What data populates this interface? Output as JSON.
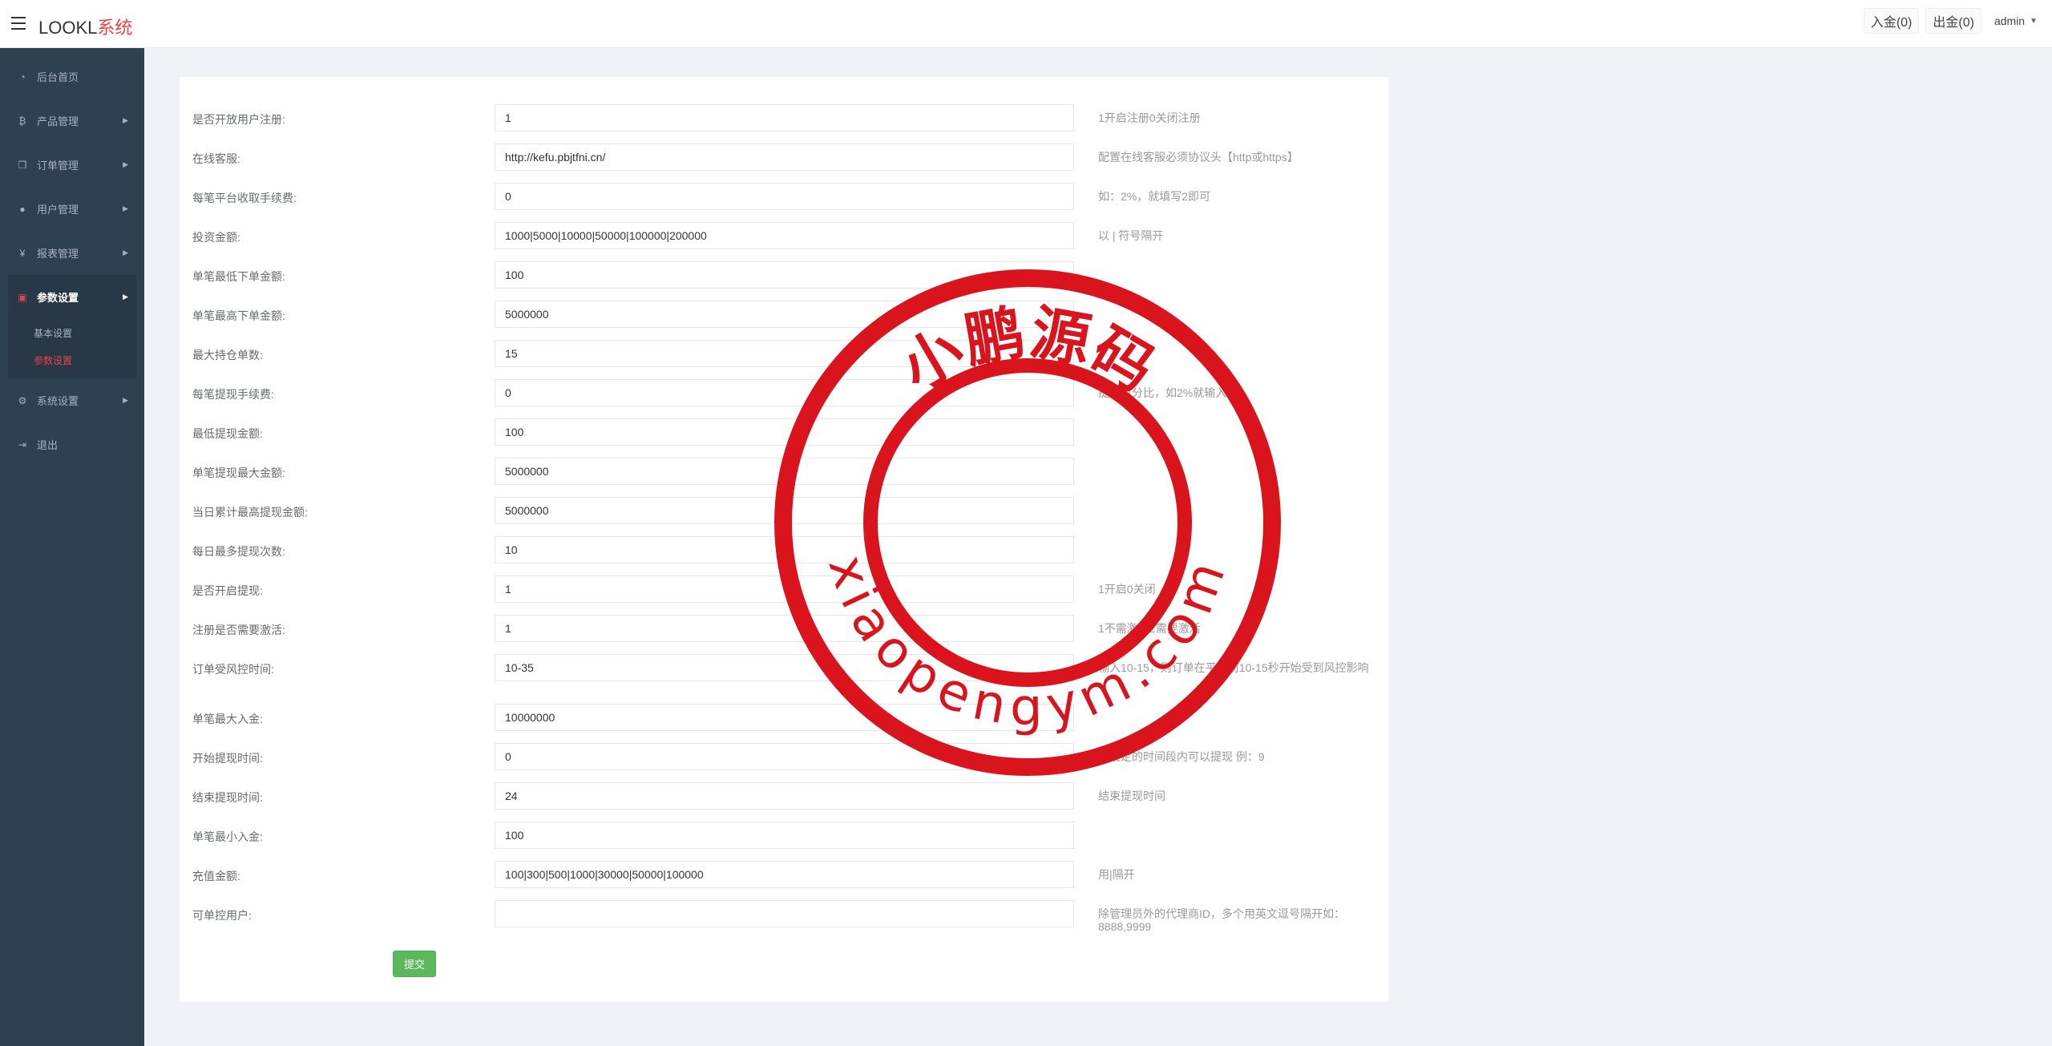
{
  "header": {
    "logo_main": "LOOKL",
    "logo_accent": "系统",
    "deposit": "入金(0)",
    "withdraw": "出金(0)",
    "user": "admin"
  },
  "sidebar": {
    "items": [
      {
        "label": "后台首页",
        "icon": "dashboard-icon",
        "has_arrow": false
      },
      {
        "label": "产品管理",
        "icon": "bitcoin-icon",
        "has_arrow": true
      },
      {
        "label": "订单管理",
        "icon": "copy-icon",
        "has_arrow": true
      },
      {
        "label": "用户管理",
        "icon": "user-icon",
        "has_arrow": true
      },
      {
        "label": "报表管理",
        "icon": "yen-icon",
        "has_arrow": true
      },
      {
        "label": "参数设置",
        "icon": "files-icon",
        "has_arrow": true
      },
      {
        "label": "系统设置",
        "icon": "gears-icon",
        "has_arrow": true
      },
      {
        "label": "退出",
        "icon": "sign-out-icon",
        "has_arrow": false
      }
    ],
    "sub_items": [
      "基本设置",
      "参数设置"
    ]
  },
  "form": {
    "rows": [
      {
        "label": "是否开放用户注册:",
        "value": "1",
        "hint": "1开启注册0关闭注册"
      },
      {
        "label": "在线客服:",
        "value": "http://kefu.pbjtfni.cn/",
        "hint": "配置在线客服必须协议头【http或https】"
      },
      {
        "label": "每笔平台收取手续费:",
        "value": "0",
        "hint": "如：2%，就填写2即可"
      },
      {
        "label": "投资金额:",
        "value": "1000|5000|10000|50000|100000|200000",
        "hint": "以 | 符号隔开"
      },
      {
        "label": "单笔最低下单金额:",
        "value": "100",
        "hint": ""
      },
      {
        "label": "单笔最高下单金额:",
        "value": "5000000",
        "hint": ""
      },
      {
        "label": "最大持仓单数:",
        "value": "15",
        "hint": ""
      },
      {
        "label": "每笔提现手续费:",
        "value": "0",
        "hint": "提现百分比，如2%就输入2"
      },
      {
        "label": "最低提现金额:",
        "value": "100",
        "hint": ""
      },
      {
        "label": "单笔提现最大金额:",
        "value": "5000000",
        "hint": ""
      },
      {
        "label": "当日累计最高提现金额:",
        "value": "5000000",
        "hint": ""
      },
      {
        "label": "每日最多提现次数:",
        "value": "10",
        "hint": ""
      },
      {
        "label": "是否开启提现:",
        "value": "1",
        "hint": "1开启0关闭"
      },
      {
        "label": "注册是否需要激活:",
        "value": "1",
        "hint": "1不需激活2需要激活"
      },
      {
        "label": "订单受风控时间:",
        "value": "10-35",
        "hint": "输入10-15，则订单在平仓前10-15秒开始受到风控影响"
      },
      {
        "label": "单笔最大入金:",
        "value": "10000000",
        "hint": ""
      },
      {
        "label": "开始提现时间:",
        "value": "0",
        "hint": "在设定的时间段内可以提现 例：9"
      },
      {
        "label": "结束提现时间:",
        "value": "24",
        "hint": "结束提现时间"
      },
      {
        "label": "单笔最小入金:",
        "value": "100",
        "hint": ""
      },
      {
        "label": "充值金额:",
        "value": "100|300|500|1000|30000|50000|100000",
        "hint": "用|隔开"
      },
      {
        "label": "可单控用户:",
        "value": "",
        "hint": "除管理员外的代理商ID，多个用英文逗号隔开如：8888,9999"
      }
    ],
    "submit_label": "提交"
  },
  "watermark": {
    "top_text": "小鹏源码",
    "bottom_text": "xiaopengym.com",
    "color": "#d9141c"
  }
}
